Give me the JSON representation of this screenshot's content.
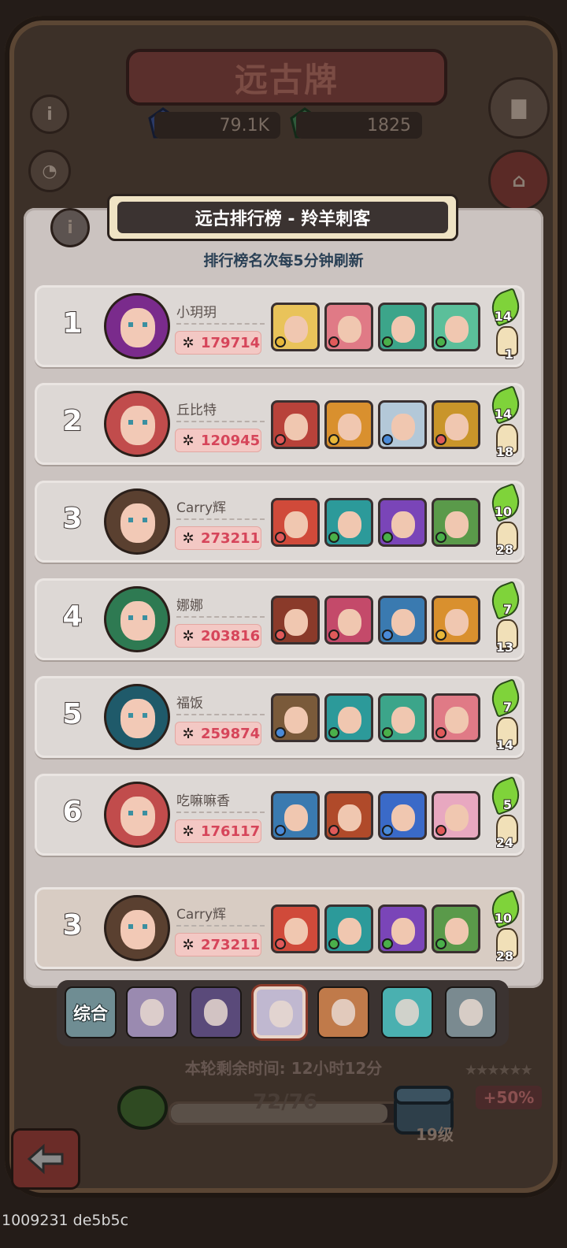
{
  "page_title": "远古牌",
  "resources": [
    {
      "icon": "blue-gem-icon",
      "value": "79.1K"
    },
    {
      "icon": "green-gem-icon",
      "value": "1825"
    }
  ],
  "board": {
    "title": "远古排行榜 - 羚羊刺客",
    "subtitle": "排行榜名次每5分钟刷新"
  },
  "rows": [
    {
      "rank": "1",
      "name": "小玥玥",
      "power": "179714",
      "leaf": "14",
      "chess": "1",
      "avatar": "#7a2b8c",
      "heroes": [
        "#e9c35a",
        "#e07a86",
        "#3ca58a",
        "#5bbf9a"
      ],
      "elems": [
        "#e8b83a",
        "#e05a5a",
        "#4ab04a",
        "#4ab04a"
      ]
    },
    {
      "rank": "2",
      "name": "丘比特",
      "power": "120945",
      "leaf": "14",
      "chess": "18",
      "avatar": "#c14c4c",
      "heroes": [
        "#b8423a",
        "#d9902e",
        "#b3c8d8",
        "#c9952a"
      ],
      "elems": [
        "#e05a5a",
        "#e8b83a",
        "#4a8ad8",
        "#e05a5a"
      ]
    },
    {
      "rank": "3",
      "name": "Carry辉",
      "power": "273211",
      "leaf": "10",
      "chess": "28",
      "avatar": "#5a4030",
      "heroes": [
        "#d04a3a",
        "#2c9a9a",
        "#7a45b8",
        "#5a9a4a"
      ],
      "elems": [
        "#e05a5a",
        "#4ab04a",
        "#4ab04a",
        "#4ab04a"
      ]
    },
    {
      "rank": "4",
      "name": "娜娜",
      "power": "203816",
      "leaf": "7",
      "chess": "13",
      "avatar": "#2e7a52",
      "heroes": [
        "#8a3a2a",
        "#c44a6a",
        "#3a7ab0",
        "#d9902e"
      ],
      "elems": [
        "#e05a5a",
        "#e05a5a",
        "#4a8ad8",
        "#e8b83a"
      ]
    },
    {
      "rank": "5",
      "name": "福饭",
      "power": "259874",
      "leaf": "7",
      "chess": "14",
      "avatar": "#1f5a6a",
      "heroes": [
        "#7a5a3a",
        "#2c9a9a",
        "#3ca58a",
        "#e07a86"
      ],
      "elems": [
        "#4a8ad8",
        "#4ab04a",
        "#4ab04a",
        "#e05a5a"
      ]
    },
    {
      "rank": "6",
      "name": "吃嘛嘛香",
      "power": "176117",
      "leaf": "5",
      "chess": "24",
      "avatar": "#c14c4c",
      "heroes": [
        "#3a7ab0",
        "#b04a2a",
        "#3a6ac8",
        "#e8a8c0"
      ],
      "elems": [
        "#4a8ad8",
        "#e05a5a",
        "#4a8ad8",
        "#e05a5a"
      ]
    }
  ],
  "my_row": {
    "rank": "3",
    "name": "Carry辉",
    "power": "273211",
    "leaf": "10",
    "chess": "28",
    "avatar": "#5a4030",
    "heroes": [
      "#d04a3a",
      "#2c9a9a",
      "#7a45b8",
      "#5a9a4a"
    ],
    "elems": [
      "#e05a5a",
      "#4ab04a",
      "#4ab04a",
      "#4ab04a"
    ]
  },
  "tabs": {
    "first_label": "综合",
    "icons": [
      {
        "name": "tab-hero-silver-hair",
        "color": "#9a8ab0"
      },
      {
        "name": "tab-hero-shadow-beast",
        "color": "#5a4a7a"
      },
      {
        "name": "tab-hero-antelope-assassin",
        "color": "#c0b8d0",
        "active": true
      },
      {
        "name": "tab-hero-ranger",
        "color": "#c07a4a"
      },
      {
        "name": "tab-hero-goblin",
        "color": "#4ab0b0"
      },
      {
        "name": "tab-hero-mech",
        "color": "#7a8a90"
      }
    ]
  },
  "footer": {
    "remaining_label": "本轮剩余时间: 12小时12分",
    "progress_text": "72/76",
    "progress_fraction": 0.947,
    "level": "19级",
    "bonus": "+50%",
    "stars": "★★★★★★"
  },
  "watermark": "1009231 de5b5c"
}
